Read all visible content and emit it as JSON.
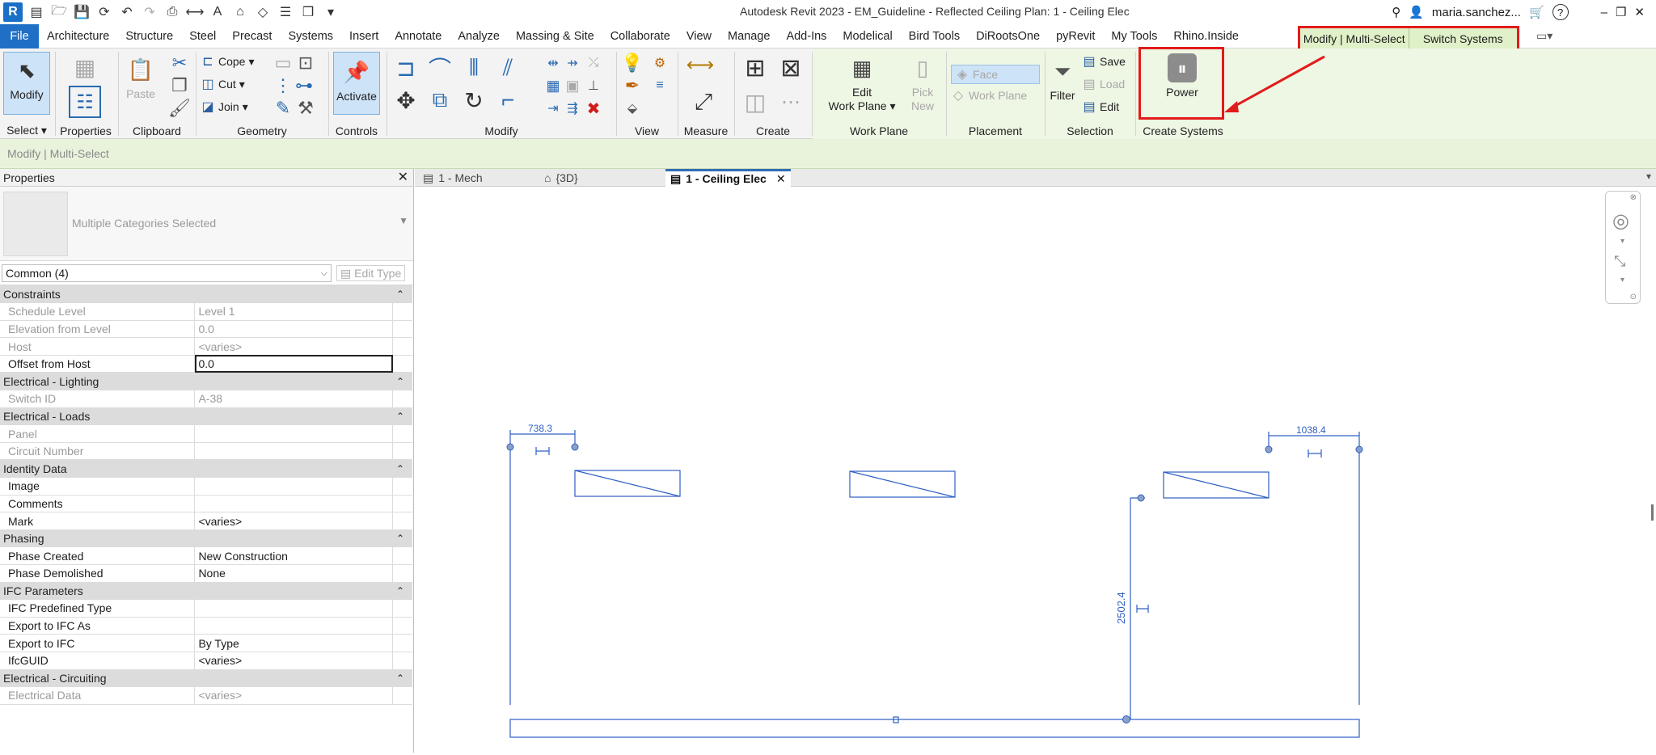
{
  "app": {
    "title": "Autodesk Revit 2023 - EM_Guideline - Reflected Ceiling Plan: 1 - Ceiling Elec",
    "logo": "R",
    "user": "maria.sanchez...",
    "help": "?",
    "window_controls": [
      "–",
      "❐",
      "✕"
    ]
  },
  "menu": {
    "file": "File",
    "tabs": [
      "Architecture",
      "Structure",
      "Steel",
      "Precast",
      "Systems",
      "Insert",
      "Annotate",
      "Analyze",
      "Massing & Site",
      "Collaborate",
      "View",
      "Manage",
      "Add-Ins",
      "Modelical",
      "Bird Tools",
      "DiRootsOne",
      "pyRevit",
      "My Tools",
      "Rhino.Inside"
    ],
    "context_tabs": [
      "Modify | Multi-Select",
      "Switch Systems"
    ]
  },
  "ribbon": {
    "select": {
      "button": "Modify",
      "label": "Select"
    },
    "properties": {
      "label": "Properties"
    },
    "clipboard": {
      "paste": "Paste",
      "label": "Clipboard"
    },
    "geometry": {
      "cope": "Cope",
      "cut": "Cut",
      "join": "Join",
      "label": "Geometry"
    },
    "controls": {
      "activate": "Activate",
      "label": "Controls"
    },
    "modify": {
      "label": "Modify"
    },
    "view": {
      "label": "View"
    },
    "measure": {
      "label": "Measure"
    },
    "create": {
      "label": "Create"
    },
    "work_plane": {
      "edit_line1": "Edit",
      "edit_line2": "Work Plane",
      "pick_line1": "Pick",
      "pick_line2": "New",
      "label": "Work Plane"
    },
    "placement": {
      "face": "Face",
      "work_plane": "Work Plane",
      "label": "Placement"
    },
    "selection": {
      "save": "Save",
      "load": "Load",
      "edit": "Edit",
      "filter": "Filter",
      "label": "Selection"
    },
    "create_systems": {
      "power": "Power",
      "label": "Create Systems"
    }
  },
  "mode_line": "Modify | Multi-Select",
  "properties_palette": {
    "title": "Properties",
    "type_name": "Multiple Categories Selected",
    "filter": "Common (4)",
    "edit_type": "Edit Type",
    "groups": [
      {
        "name": "Constraints",
        "rows": [
          {
            "k": "Schedule Level",
            "v": "Level 1",
            "dis": true
          },
          {
            "k": "Elevation from Level",
            "v": "0.0",
            "dis": true
          },
          {
            "k": "Host",
            "v": "<varies>",
            "dis": true
          },
          {
            "k": "Offset from Host",
            "v": "0.0",
            "dis": false,
            "edit": true
          }
        ]
      },
      {
        "name": "Electrical - Lighting",
        "rows": [
          {
            "k": "Switch ID",
            "v": "A-38",
            "dis": true
          }
        ]
      },
      {
        "name": "Electrical - Loads",
        "rows": [
          {
            "k": "Panel",
            "v": "",
            "dis": true
          },
          {
            "k": "Circuit Number",
            "v": "",
            "dis": true
          }
        ]
      },
      {
        "name": "Identity Data",
        "rows": [
          {
            "k": "Image",
            "v": "",
            "dis": false
          },
          {
            "k": "Comments",
            "v": "",
            "dis": false
          },
          {
            "k": "Mark",
            "v": "<varies>",
            "dis": false
          }
        ]
      },
      {
        "name": "Phasing",
        "rows": [
          {
            "k": "Phase Created",
            "v": "New Construction",
            "dis": false
          },
          {
            "k": "Phase Demolished",
            "v": "None",
            "dis": false
          }
        ]
      },
      {
        "name": "IFC Parameters",
        "rows": [
          {
            "k": "IFC Predefined Type",
            "v": "",
            "dis": false
          },
          {
            "k": "Export to IFC As",
            "v": "",
            "dis": false
          },
          {
            "k": "Export to IFC",
            "v": "By Type",
            "dis": false
          },
          {
            "k": "IfcGUID",
            "v": "<varies>",
            "dis": false
          }
        ]
      },
      {
        "name": "Electrical - Circuiting",
        "rows": [
          {
            "k": "Electrical Data",
            "v": "<varies>",
            "dis": true
          }
        ]
      }
    ]
  },
  "view_tabs": [
    {
      "label": "1 - Mech",
      "active": false
    },
    {
      "label": "{3D}",
      "active": false
    },
    {
      "label": "1 - Ceiling Elec",
      "active": true
    }
  ],
  "drawing": {
    "dim_left": "738.3",
    "dim_right": "1038.4",
    "dim_vertical": "2502.4"
  },
  "colors": {
    "accent": "#1f6fc7",
    "context_tab": "#e0f0c8",
    "highlight": "#e21b1b",
    "annotation": "#2f5fc4"
  }
}
